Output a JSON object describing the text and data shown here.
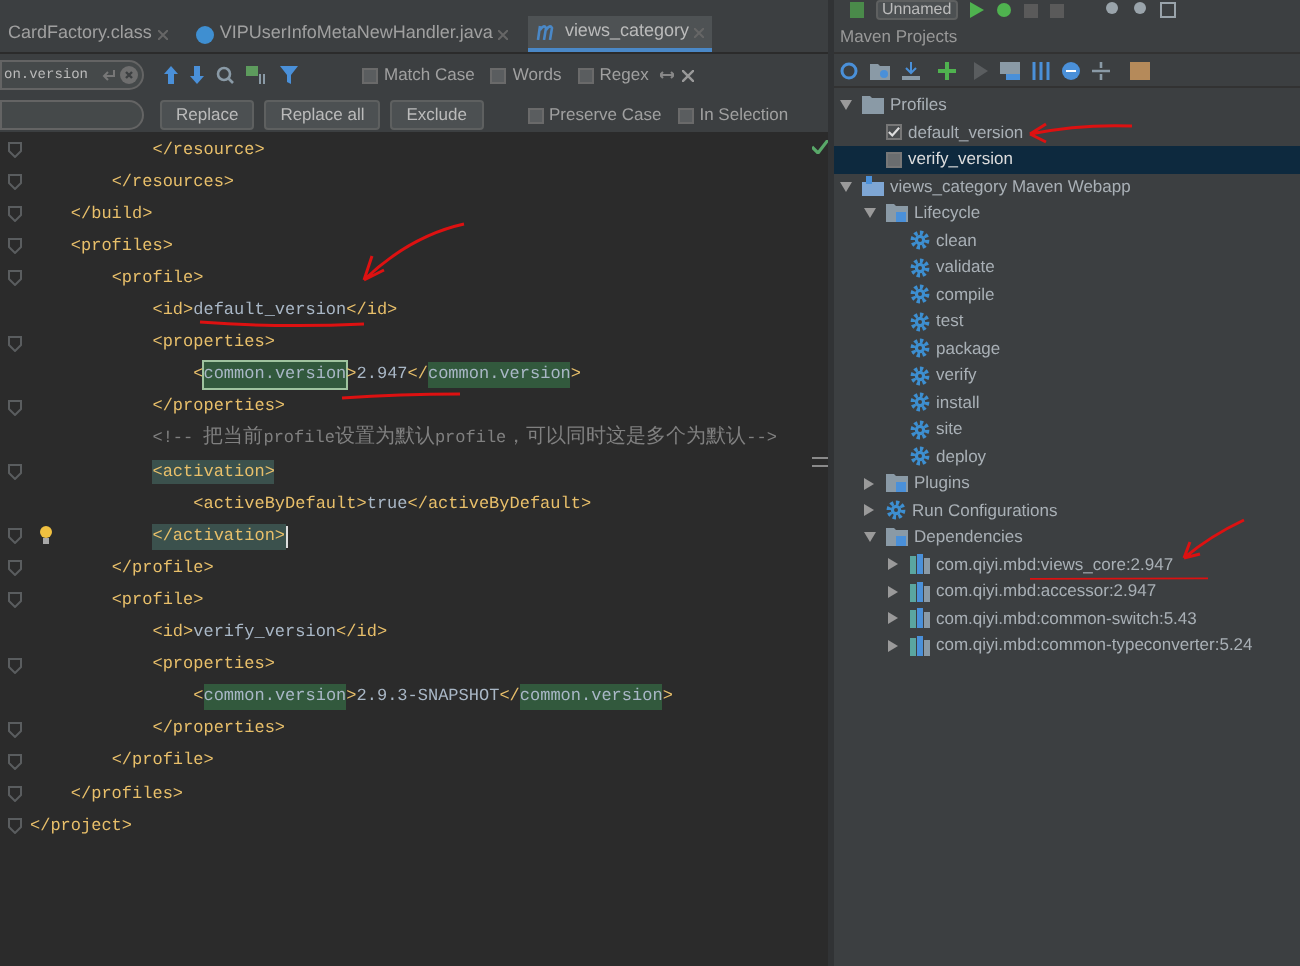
{
  "run_toolbar": {
    "configuration": "Unnamed"
  },
  "editor_tabs": [
    {
      "label": "CardFactory.class",
      "kind": "class",
      "selected": false
    },
    {
      "label": "VIPUserInfoMetaNewHandler.java",
      "kind": "java",
      "selected": false
    },
    {
      "label": "views_category",
      "kind": "maven",
      "selected": true
    }
  ],
  "find_bar": {
    "search_value": "on.version",
    "options_row_1": [
      {
        "label": "Match Case",
        "checked": false
      },
      {
        "label": "Words",
        "checked": false
      },
      {
        "label": "Regex",
        "checked": false
      }
    ],
    "buttons": [
      "Replace",
      "Replace all",
      "Exclude"
    ],
    "options_row_2": [
      {
        "label": "Preserve Case",
        "checked": false
      },
      {
        "label": "In Selection",
        "checked": false
      }
    ]
  },
  "code_lines": [
    {
      "fold": true,
      "segments": [
        {
          "text": "            </resource>",
          "kind": "tag"
        }
      ]
    },
    {
      "fold": true,
      "segments": [
        {
          "text": "        </resources>",
          "kind": "tag"
        }
      ]
    },
    {
      "fold": true,
      "segments": [
        {
          "text": "    </build>",
          "kind": "tag"
        }
      ]
    },
    {
      "fold": true,
      "segments": [
        {
          "text": "    <profiles>",
          "kind": "tag"
        }
      ]
    },
    {
      "fold": true,
      "segments": [
        {
          "text": "        <profile>",
          "kind": "tag"
        }
      ]
    },
    {
      "fold": false,
      "segments": [
        {
          "text": "            <id>",
          "kind": "tag"
        },
        {
          "text": "default_version",
          "kind": "text"
        },
        {
          "text": "</id>",
          "kind": "tag"
        }
      ]
    },
    {
      "fold": true,
      "segments": [
        {
          "text": "            <properties>",
          "kind": "tag"
        }
      ]
    },
    {
      "fold": false,
      "segments": [
        {
          "text": "                <",
          "kind": "tag"
        },
        {
          "text": "common.version",
          "kind": "current_match"
        },
        {
          "text": ">",
          "kind": "tag"
        },
        {
          "text": "2.947",
          "kind": "text"
        },
        {
          "text": "</",
          "kind": "tag"
        },
        {
          "text": "common.version",
          "kind": "match"
        },
        {
          "text": ">",
          "kind": "tag"
        }
      ]
    },
    {
      "fold": true,
      "segments": [
        {
          "text": "            </properties>",
          "kind": "tag"
        }
      ]
    },
    {
      "fold": false,
      "segments": [
        {
          "text": "            <!-- 把当前profile设置为默认profile，可以同时这是多个为默认-->",
          "kind": "comment"
        }
      ]
    },
    {
      "fold": true,
      "segments": [
        {
          "text": "            <activation>",
          "kind": "paired_tag"
        }
      ]
    },
    {
      "fold": false,
      "segments": [
        {
          "text": "                <activeByDefault>",
          "kind": "tag"
        },
        {
          "text": "true",
          "kind": "text"
        },
        {
          "text": "</activeByDefault>",
          "kind": "tag"
        }
      ]
    },
    {
      "fold": true,
      "bulb": true,
      "caret": true,
      "segments": [
        {
          "text": "            </activation>",
          "kind": "paired_tag"
        }
      ]
    },
    {
      "fold": true,
      "segments": [
        {
          "text": "        </profile>",
          "kind": "tag"
        }
      ]
    },
    {
      "fold": true,
      "segments": [
        {
          "text": "        <profile>",
          "kind": "tag"
        }
      ]
    },
    {
      "fold": false,
      "segments": [
        {
          "text": "            <id>",
          "kind": "tag"
        },
        {
          "text": "verify_version",
          "kind": "text"
        },
        {
          "text": "</id>",
          "kind": "tag"
        }
      ]
    },
    {
      "fold": true,
      "segments": [
        {
          "text": "            <properties>",
          "kind": "tag"
        }
      ]
    },
    {
      "fold": false,
      "segments": [
        {
          "text": "                <",
          "kind": "tag"
        },
        {
          "text": "common.version",
          "kind": "match"
        },
        {
          "text": ">",
          "kind": "tag"
        },
        {
          "text": "2.9.3-SNAPSHOT",
          "kind": "text"
        },
        {
          "text": "</",
          "kind": "tag"
        },
        {
          "text": "common.version",
          "kind": "match"
        },
        {
          "text": ">",
          "kind": "tag"
        }
      ]
    },
    {
      "fold": true,
      "segments": [
        {
          "text": "            </properties>",
          "kind": "tag"
        }
      ]
    },
    {
      "fold": true,
      "segments": [
        {
          "text": "        </profile>",
          "kind": "tag"
        }
      ]
    },
    {
      "fold": true,
      "segments": [
        {
          "text": "    </profiles>",
          "kind": "tag"
        }
      ]
    },
    {
      "fold": true,
      "segments": [
        {
          "text": "</project>",
          "kind": "tag"
        }
      ]
    }
  ],
  "maven_panel": {
    "title": "Maven Projects",
    "tree": [
      {
        "label": "Profiles",
        "kind": "profiles",
        "expanded": true,
        "selected": false,
        "children": [
          {
            "label": "default_version",
            "kind": "profile",
            "checked": true,
            "selected": false
          },
          {
            "label": "verify_version",
            "kind": "profile",
            "checked": false,
            "selected": true
          }
        ]
      },
      {
        "label": "views_category Maven Webapp",
        "kind": "project",
        "expanded": true,
        "selected": false,
        "children": [
          {
            "label": "Lifecycle",
            "kind": "folder",
            "expanded": true,
            "selected": false,
            "children": [
              {
                "label": "clean",
                "kind": "phase",
                "selected": false
              },
              {
                "label": "validate",
                "kind": "phase",
                "selected": false
              },
              {
                "label": "compile",
                "kind": "phase",
                "selected": false
              },
              {
                "label": "test",
                "kind": "phase",
                "selected": false
              },
              {
                "label": "package",
                "kind": "phase",
                "selected": false
              },
              {
                "label": "verify",
                "kind": "phase",
                "selected": false
              },
              {
                "label": "install",
                "kind": "phase",
                "selected": false
              },
              {
                "label": "site",
                "kind": "phase",
                "selected": false
              },
              {
                "label": "deploy",
                "kind": "phase",
                "selected": false
              }
            ]
          },
          {
            "label": "Plugins",
            "kind": "folder",
            "expanded": false,
            "selected": false
          },
          {
            "label": "Run Configurations",
            "kind": "phase",
            "expanded": false,
            "selected": false
          },
          {
            "label": "Dependencies",
            "kind": "folder",
            "expanded": true,
            "selected": false,
            "children": [
              {
                "label": "com.qiyi.mbd:views_core:2.947",
                "kind": "library",
                "expanded": false,
                "selected": false
              },
              {
                "label": "com.qiyi.mbd:accessor:2.947",
                "kind": "library",
                "expanded": false,
                "selected": false
              },
              {
                "label": "com.qiyi.mbd:common-switch:5.43",
                "kind": "library",
                "expanded": false,
                "selected": false
              },
              {
                "label": "com.qiyi.mbd:common-typeconverter:5.24",
                "kind": "library",
                "expanded": false,
                "selected": false
              }
            ]
          }
        ]
      }
    ]
  }
}
